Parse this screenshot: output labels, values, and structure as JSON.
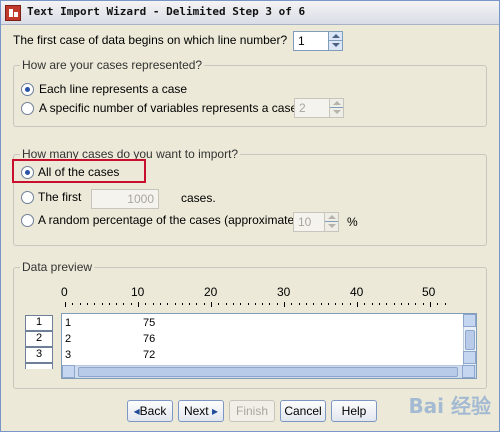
{
  "window": {
    "title": "Text Import Wizard - Delimited Step 3 of 6"
  },
  "first_line": {
    "question": "The first case of data begins on which line number?",
    "value": "1"
  },
  "cases_represented": {
    "legend": "How are your cases represented?",
    "option_each_line": "Each line represents a case",
    "option_specific": "A specific number of variables represents a case:",
    "specific_value": "2"
  },
  "cases_import": {
    "legend": "How many cases do you want to import?",
    "option_all": "All of the cases",
    "option_first": "The first",
    "first_value": "1000",
    "cases_suffix": "cases.",
    "option_random": "A random percentage of the cases (approximate):",
    "random_value": "10",
    "percent_sign": "%"
  },
  "preview": {
    "legend": "Data preview",
    "ruler": [
      "0",
      "10",
      "20",
      "30",
      "40",
      "50"
    ],
    "rows": [
      {
        "num": "1",
        "c1": "1",
        "c2": "75"
      },
      {
        "num": "2",
        "c1": "2",
        "c2": "76"
      },
      {
        "num": "3",
        "c1": "3",
        "c2": "72"
      }
    ]
  },
  "buttons": {
    "back": "Back",
    "next": "Next",
    "finish": "Finish",
    "cancel": "Cancel",
    "help": "Help"
  },
  "watermark": "Bai 经验"
}
